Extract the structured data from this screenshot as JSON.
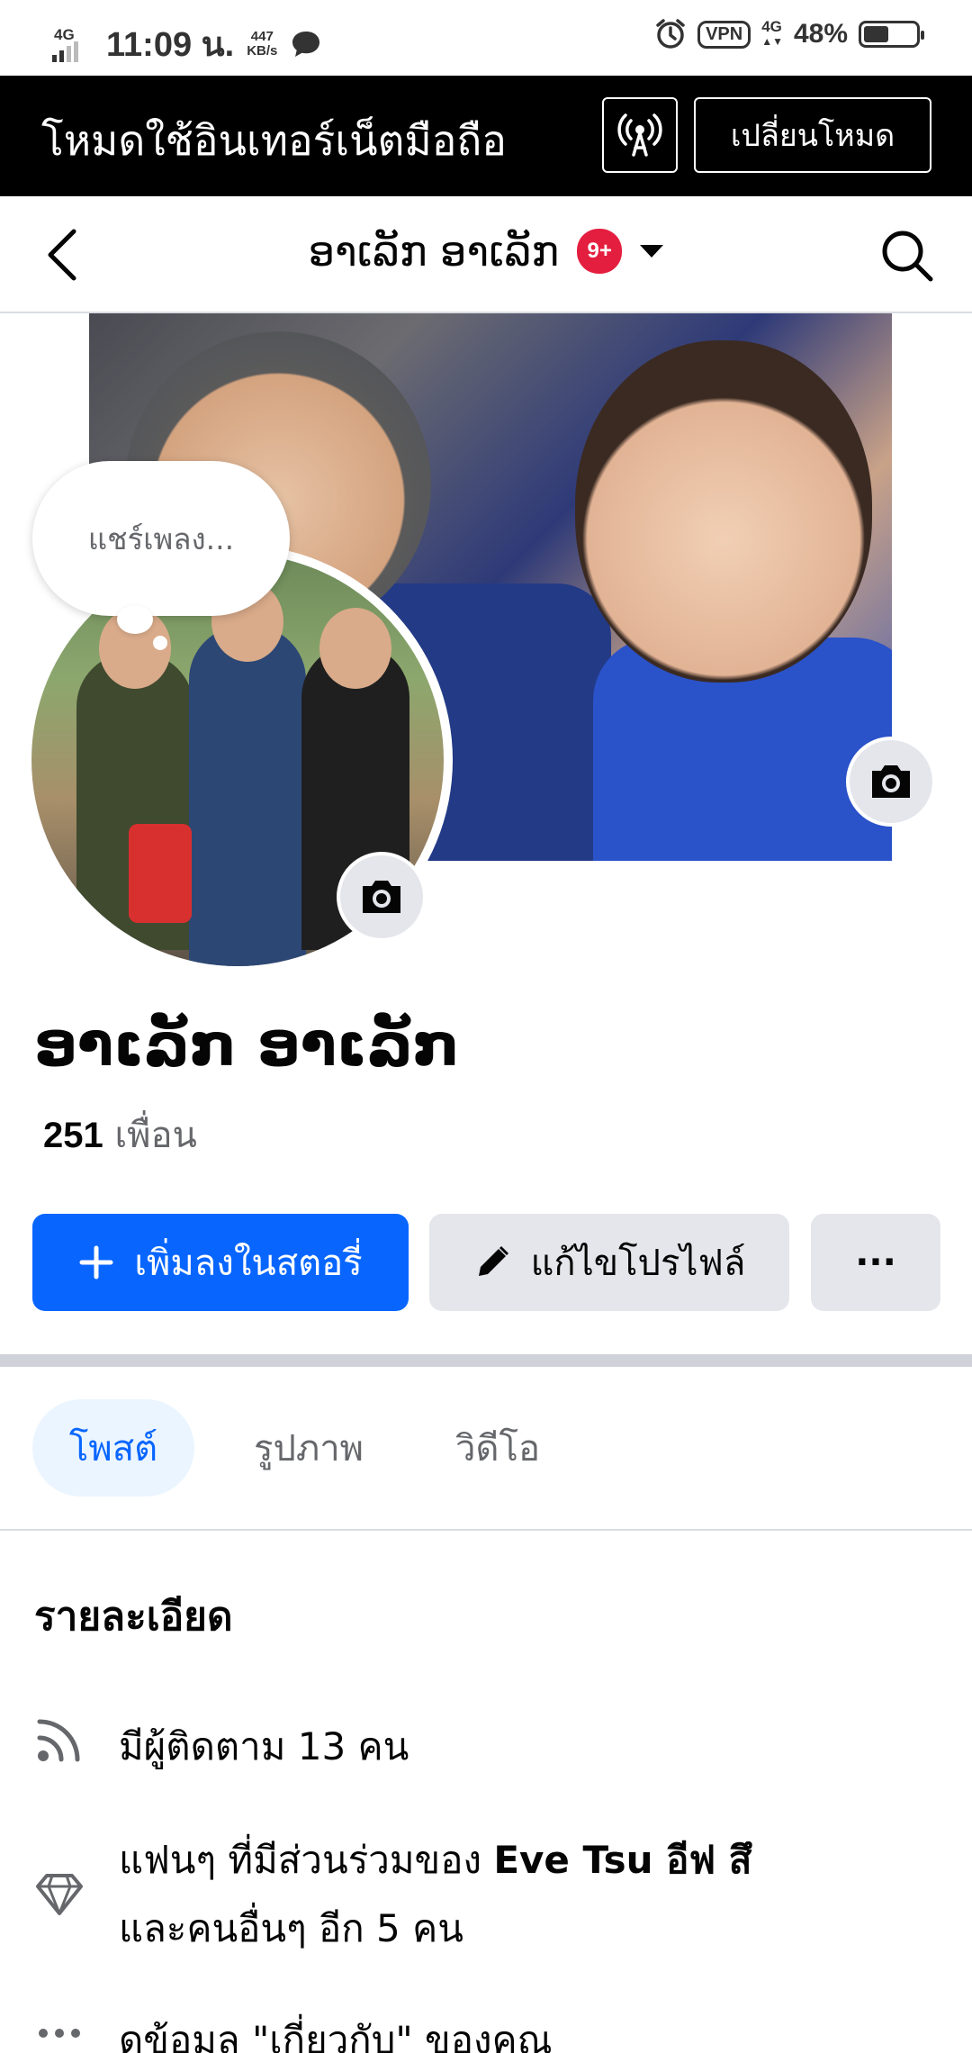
{
  "status_bar": {
    "network": "4G",
    "time": "11:09 น.",
    "speed_value": "447",
    "speed_unit": "KB/s",
    "vpn": "VPN",
    "network_right": "4G",
    "battery": "48%",
    "battery_level": 0.48
  },
  "banner": {
    "title": "โหมดใช้อินเทอร์เน็ตมือถือ",
    "switch_label": "เปลี่ยนโหมด"
  },
  "nav": {
    "title": "ອາເລັກ ອາເລັກ",
    "badge": "9+"
  },
  "note": {
    "text": "แชร์เพลง..."
  },
  "profile": {
    "name": "ອາເລັກ ອາເລັກ",
    "friends_count": "251",
    "friends_label": "เพื่อน"
  },
  "actions": {
    "story_label": "เพิ่มลงในสตอรี่",
    "edit_label": "แก้ไขโปรไฟล์",
    "more_label": "···"
  },
  "tabs": [
    {
      "label": "โพสต์",
      "active": true
    },
    {
      "label": "รูปภาพ",
      "active": false
    },
    {
      "label": "วิดีโอ",
      "active": false
    }
  ],
  "details": {
    "title": "รายละเอียด",
    "followers": "มีผู้ติดตาม 13 คน",
    "fans_prefix": "แฟนๆ ที่มีส่วนร่วมของ ",
    "fans_name": "Eve Tsu อีฟ สึ",
    "fans_suffix": "และคนอื่นๆ อีก 5 คน",
    "about": "ดูข้อมูล \"เกี่ยวกับ\" ของคุณ"
  },
  "colors": {
    "brand_blue": "#0866ff",
    "badge_red": "#e41e3f",
    "button_gray": "#e4e6eb",
    "secondary_text": "#65676b"
  }
}
